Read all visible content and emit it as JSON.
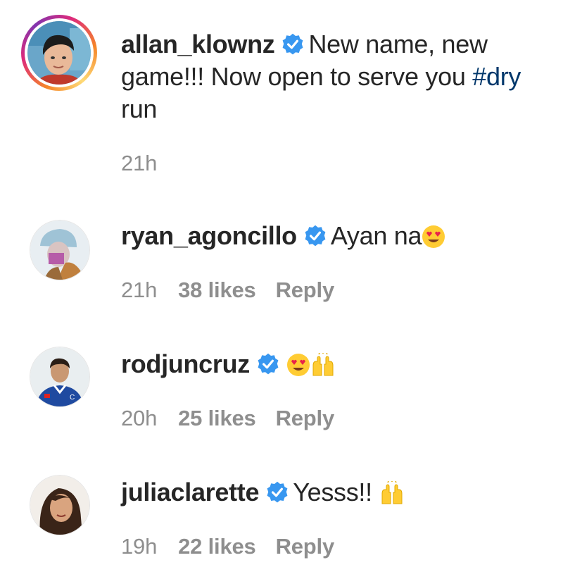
{
  "comments": [
    {
      "username": "allan_klownz",
      "text_before": "New name, new game!!! Now open to serve you ",
      "hashtag": "#dry",
      "text_after": "run",
      "time": "21h"
    },
    {
      "username": "ryan_agoncillo",
      "text": "Ayan na",
      "emojis": [
        "heart-eyes-emoji"
      ],
      "time": "21h",
      "likes": "38 likes",
      "reply": "Reply"
    },
    {
      "username": "rodjuncruz",
      "text": "",
      "emojis": [
        "heart-eyes-emoji",
        "raising-hands-emoji"
      ],
      "time": "20h",
      "likes": "25 likes",
      "reply": "Reply"
    },
    {
      "username": "juliaclarette",
      "text": "Yesss!!",
      "emojis": [
        "raising-hands-emoji"
      ],
      "time": "19h",
      "likes": "22 likes",
      "reply": "Reply"
    }
  ],
  "colors": {
    "text": "#262626",
    "meta": "#8e8e8e",
    "hashtag": "#00376b",
    "verified": "#3897f0"
  }
}
